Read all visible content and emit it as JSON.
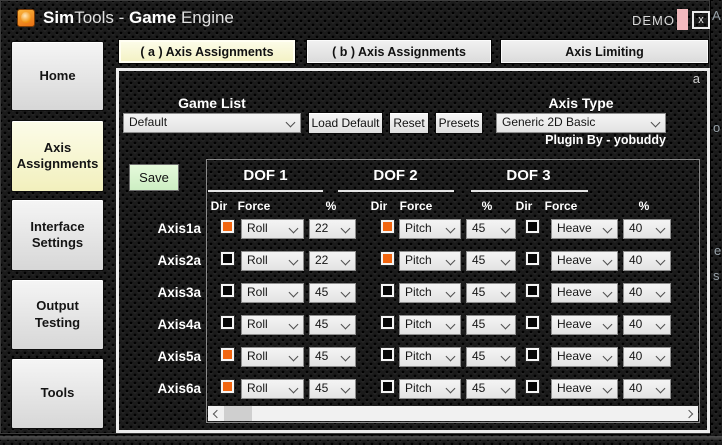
{
  "colors": {
    "accent_orange": "#F26611",
    "active_cream": "#F3F1C2",
    "save_green": "#CDEEC3",
    "minimize_pink": "#F3B9BE",
    "control_face": "#EDEDED"
  },
  "title_bar": {
    "brand_bold": "Sim",
    "brand_rest": "Tools - ",
    "product_bold": "Game",
    "product_rest": " Engine",
    "demo": "DEMO",
    "close": "x"
  },
  "sidebar": {
    "items": [
      {
        "label": "Home"
      },
      {
        "label": "Axis Assignments",
        "active": true
      },
      {
        "label": "Interface Settings"
      },
      {
        "label": "Output Testing"
      },
      {
        "label": "Tools"
      }
    ]
  },
  "tabs": [
    {
      "label": "( a ) Axis Assignments",
      "active": true
    },
    {
      "label": "( b ) Axis Assignments"
    },
    {
      "label": "Axis Limiting"
    }
  ],
  "main": {
    "corner_label": "a",
    "game_list": {
      "label": "Game List",
      "selected": "Default",
      "load_default": "Load Default",
      "reset": "Reset",
      "presets": "Presets"
    },
    "axis_type": {
      "label": "Axis Type",
      "selected": "Generic 2D Basic",
      "plugin_by": "Plugin By - yobuddy"
    },
    "save": "Save",
    "table": {
      "groups": [
        {
          "name": "DOF 1",
          "dir": "Dir",
          "force": "Force",
          "pct": "%"
        },
        {
          "name": "DOF 2",
          "dir": "Dir",
          "force": "Force",
          "pct": "%"
        },
        {
          "name": "DOF 3",
          "dir": "Dir",
          "force": "Force",
          "pct": "%"
        }
      ],
      "rows": [
        {
          "name": "Axis1a",
          "dof1": {
            "dir_on": true,
            "force": "Roll",
            "pct": "22"
          },
          "dof2": {
            "dir_on": true,
            "force": "Pitch",
            "pct": "45"
          },
          "dof3": {
            "dir_on": false,
            "force": "Heave",
            "pct": "40"
          }
        },
        {
          "name": "Axis2a",
          "dof1": {
            "dir_on": false,
            "force": "Roll",
            "pct": "22"
          },
          "dof2": {
            "dir_on": true,
            "force": "Pitch",
            "pct": "45"
          },
          "dof3": {
            "dir_on": false,
            "force": "Heave",
            "pct": "40"
          }
        },
        {
          "name": "Axis3a",
          "dof1": {
            "dir_on": false,
            "force": "Roll",
            "pct": "45"
          },
          "dof2": {
            "dir_on": false,
            "force": "Pitch",
            "pct": "45"
          },
          "dof3": {
            "dir_on": false,
            "force": "Heave",
            "pct": "40"
          }
        },
        {
          "name": "Axis4a",
          "dof1": {
            "dir_on": false,
            "force": "Roll",
            "pct": "45"
          },
          "dof2": {
            "dir_on": false,
            "force": "Pitch",
            "pct": "45"
          },
          "dof3": {
            "dir_on": false,
            "force": "Heave",
            "pct": "40"
          }
        },
        {
          "name": "Axis5a",
          "dof1": {
            "dir_on": true,
            "force": "Roll",
            "pct": "45"
          },
          "dof2": {
            "dir_on": false,
            "force": "Pitch",
            "pct": "45"
          },
          "dof3": {
            "dir_on": false,
            "force": "Heave",
            "pct": "40"
          }
        },
        {
          "name": "Axis6a",
          "dof1": {
            "dir_on": true,
            "force": "Roll",
            "pct": "45"
          },
          "dof2": {
            "dir_on": false,
            "force": "Pitch",
            "pct": "45"
          },
          "dof3": {
            "dir_on": false,
            "force": "Heave",
            "pct": "40"
          }
        }
      ]
    }
  },
  "icons": {
    "logo": "simtools-flame",
    "combo": "chevron-down",
    "scroll_left": "chevron-left",
    "scroll_right": "chevron-right"
  },
  "background_edge": {
    "letters": [
      "A",
      "o",
      "e",
      "s"
    ]
  }
}
